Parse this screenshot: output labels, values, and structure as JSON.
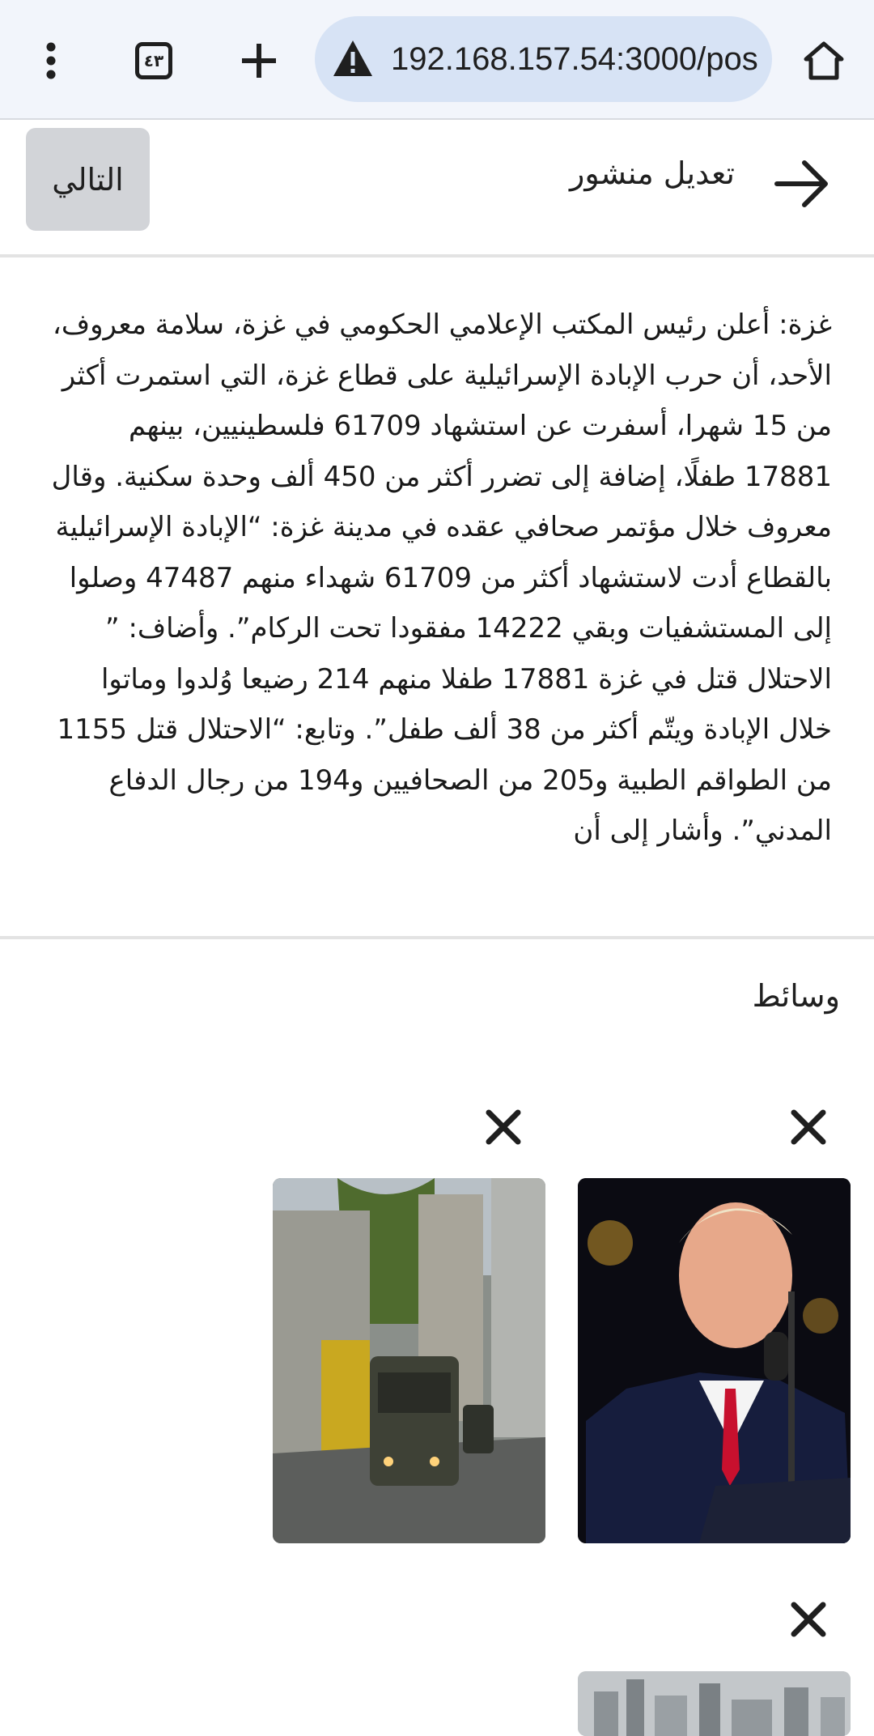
{
  "browser": {
    "url": "192.168.157.54:3000/pos",
    "tab_count": "٤٣"
  },
  "header": {
    "title": "تعديل منشور",
    "next_label": "التالي"
  },
  "post": {
    "text": "غزة: أعلن رئيس المكتب الإعلامي الحكومي في غزة، سلامة معروف، الأحد، أن حرب الإبادة الإسرائيلية على قطاع غزة، التي استمرت أكثر من 15 شهرا، أسفرت عن استشهاد 61709 فلسطينيين، بينهم 17881 طفلًا، إضافة إلى تضرر أكثر من 450 ألف وحدة سكنية. وقال معروف خلال مؤتمر صحافي عقده في مدينة غزة: “الإبادة الإسرائيلية بالقطاع أدت لاستشهاد أكثر من 61709 شهداء منهم 47487 وصلوا إلى المستشفيات وبقي 14222 مفقودا تحت الركام”. وأضاف: ” الاحتلال قتل في غزة 17881 طفلا منهم 214 رضيعا وُلدوا وماتوا خلال الإبادة ويتّم أكثر من 38 ألف طفل”. وتابع: “الاحتلال قتل 1155 من الطواقم الطبية و205 من الصحافيين و194 من رجال الدفاع المدني”. وأشار إلى أن"
  },
  "media": {
    "label": "وسائط",
    "items": [
      {
        "description": "speaker at microphone"
      },
      {
        "description": "military vehicles in street"
      },
      {
        "description": "city skyline"
      }
    ]
  },
  "colors": {
    "chrome_bg": "#f2f5fb",
    "url_pill": "#d7e3f5",
    "button_bg": "#d2d4d8",
    "divider": "#e3e3e3"
  }
}
